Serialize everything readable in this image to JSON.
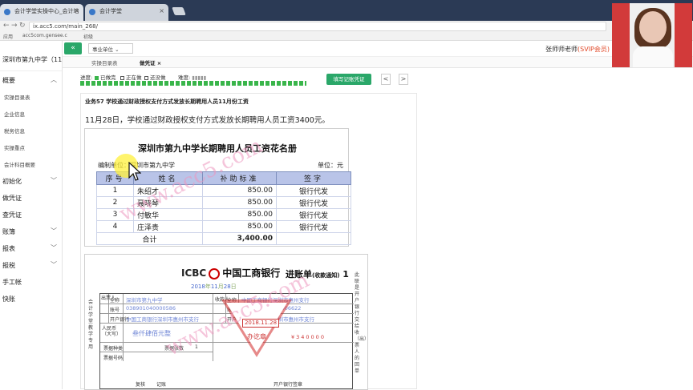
{
  "browser": {
    "tabs": [
      {
        "title": "会计学堂实操中心_会计培"
      },
      {
        "title": "会计学堂"
      }
    ],
    "url": "ix.acc5.com/main_268/",
    "bookmarks": [
      "应用",
      "acc5com.gensee.c",
      "初级"
    ]
  },
  "sidebar": {
    "school": "深圳市第九中学（11月）",
    "items": [
      {
        "label": "概要",
        "expandable": true
      },
      {
        "label": "实操目录表",
        "sub": true
      },
      {
        "label": "企业信息",
        "sub": true
      },
      {
        "label": "税务信息",
        "sub": true
      },
      {
        "label": "实操重点",
        "sub": true
      },
      {
        "label": "会计科目概要",
        "sub": true
      },
      {
        "label": "初始化",
        "expandable": true
      },
      {
        "label": "做凭证"
      },
      {
        "label": "查凭证"
      },
      {
        "label": "账簿",
        "expandable": true
      },
      {
        "label": "报表",
        "expandable": true
      },
      {
        "label": "报税",
        "expandable": true
      },
      {
        "label": "手工帐"
      },
      {
        "label": "快账"
      }
    ]
  },
  "header": {
    "collapse_icon": "«",
    "department": "事业单位",
    "user": "张师师老师",
    "vip": "(SVIP会员)"
  },
  "subtabs": [
    "实操目录表",
    "做凭证"
  ],
  "progress": {
    "label": "进度:",
    "done": "已做完",
    "doing": "正在做",
    "todo": "还没做",
    "difficulty": "难度:",
    "fill_button": "填写记账凭证",
    "prev": "<",
    "next": ">",
    "colors": {
      "done": "#39b54a",
      "doing": "#ffffff",
      "todo": "#ffffff"
    }
  },
  "task": {
    "title": "业务57 学校通过财政授权支付方式发放长期聘用人员11月份工资",
    "description": "11月28日，学校通过财政授权支付方式发放长期聘用人员工资3400元。"
  },
  "payroll": {
    "title": "深圳市第九中学长期聘用人员工资花名册",
    "org_label": "编制单位：深圳市第九中学",
    "unit_label": "单位：元",
    "headers": [
      "序号",
      "姓名",
      "补助标准",
      "签字"
    ],
    "rows": [
      [
        "1",
        "朱绍才",
        "850.00",
        "银行代发"
      ],
      [
        "2",
        "聂晓琴",
        "850.00",
        "银行代发"
      ],
      [
        "3",
        "付敏华",
        "850.00",
        "银行代发"
      ],
      [
        "4",
        "庄泽贵",
        "850.00",
        "银行代发"
      ]
    ],
    "total_label": "合计",
    "total_value": "3,400.00"
  },
  "slip": {
    "brand": "ICBC",
    "bank": "中国工商银行",
    "type": "进账单",
    "type_note": "(收款通知)",
    "copy_no": "1",
    "date_prefix": "2018",
    "date_mid": "11",
    "date_day": "28",
    "date_units": [
      "年",
      "月",
      "日"
    ],
    "side_text": "会计学堂教学专用",
    "right_text": "此联是开户银行交给收（出）票人的回单",
    "payer_label": "出票人",
    "payee_label": "收款人",
    "full_name": "全称",
    "account": "账号",
    "bank_label": "开户银行",
    "payer_name": "深圳市第九中学",
    "payer_account": "038901040000586",
    "payer_bank": "中国工商银行深圳市惠州市支行",
    "payee_name": "中国工商银行深圳市惠州支行",
    "payee_account": "630881757000006622",
    "payee_bank": "中国工商银行深圳市惠州市支行",
    "amount_label": "人民币（大写）",
    "amount_words": "叁仟肆佰元整",
    "amount_digits": "¥340000",
    "bill_type": "票据种类",
    "bill_count": "票据张数",
    "bill_count_val": "1",
    "bill_no": "票据号码",
    "review": "复核",
    "bookkeep": "记账",
    "stamp_label": "开户银行签章",
    "stamp_date": "2018.11.28",
    "stamp_text": "办讫章"
  },
  "watermark": "www.acc5.com"
}
